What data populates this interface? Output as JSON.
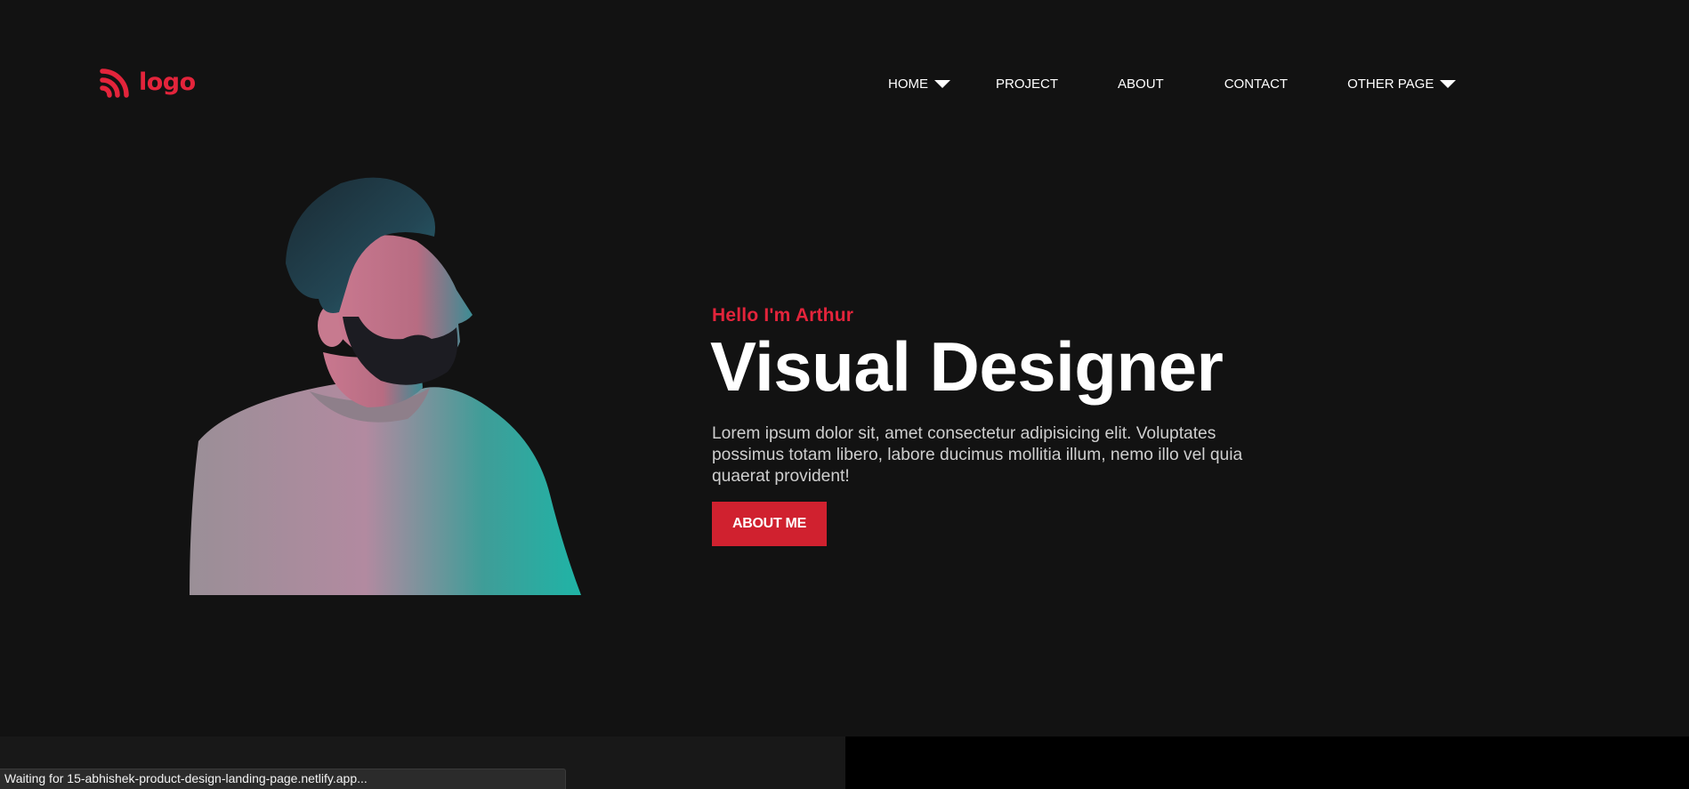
{
  "header": {
    "logo_text": "logo",
    "brand_color": "#e3243b",
    "nav": [
      {
        "label": "HOME",
        "has_dropdown": true
      },
      {
        "label": "PROJECT",
        "has_dropdown": false
      },
      {
        "label": "ABOUT",
        "has_dropdown": false
      },
      {
        "label": "CONTACT",
        "has_dropdown": false
      },
      {
        "label": "OTHER PAGE",
        "has_dropdown": true
      }
    ]
  },
  "hero": {
    "greeting": "Hello I'm Arthur",
    "title": "Visual Designer",
    "description": "Lorem ipsum dolor sit, amet consectetur adipisicing elit. Voluptates possimus totam libero, labore ducimus mollitia illum, nemo illo vel quia quaerat provident!",
    "cta_label": "ABOUT ME",
    "accent_color": "#d0212f"
  },
  "status_bar": {
    "text": "Waiting for 15-abhishek-product-design-landing-page.netlify.app..."
  }
}
